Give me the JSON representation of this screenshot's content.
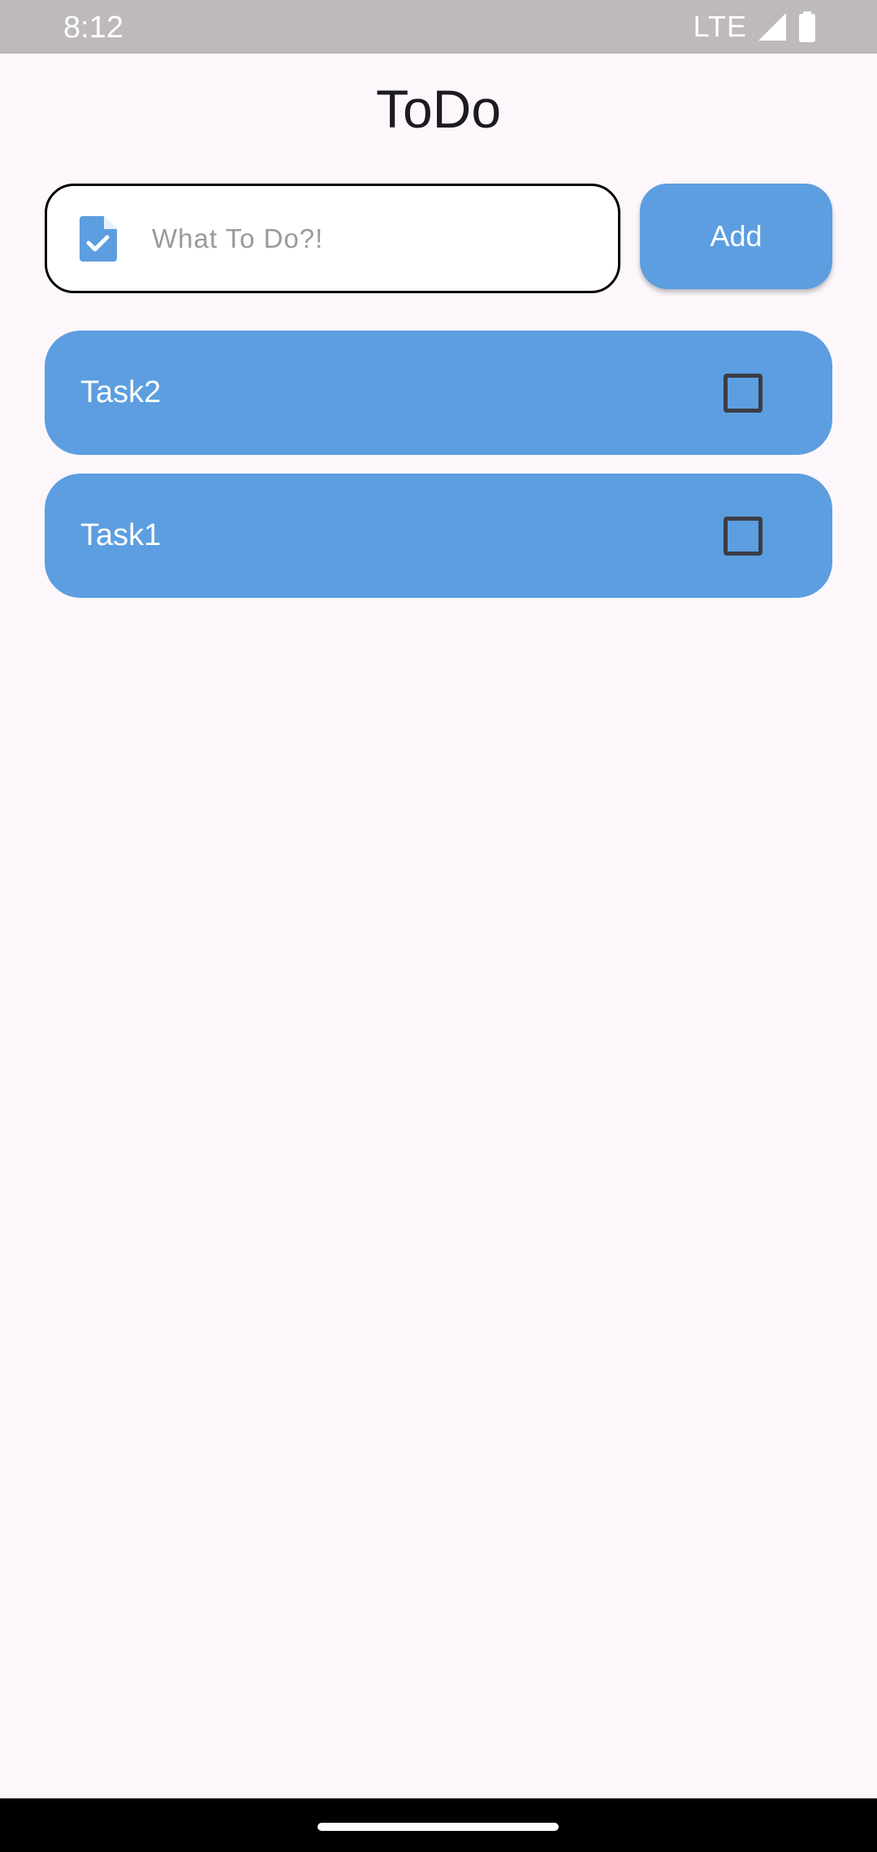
{
  "status_bar": {
    "time": "8:12",
    "network": "LTE",
    "signal_icon": "signal-icon",
    "battery_icon": "battery-icon"
  },
  "app": {
    "title": "ToDo"
  },
  "input": {
    "placeholder": "What To Do?!",
    "value": "",
    "icon": "task-file-icon"
  },
  "add_button": {
    "label": "Add"
  },
  "tasks": [
    {
      "label": "Task2",
      "checked": false
    },
    {
      "label": "Task1",
      "checked": false
    }
  ],
  "colors": {
    "accent": "#5c9ee0",
    "background": "#fdf7fc",
    "status_bar": "#bdb9bd"
  }
}
